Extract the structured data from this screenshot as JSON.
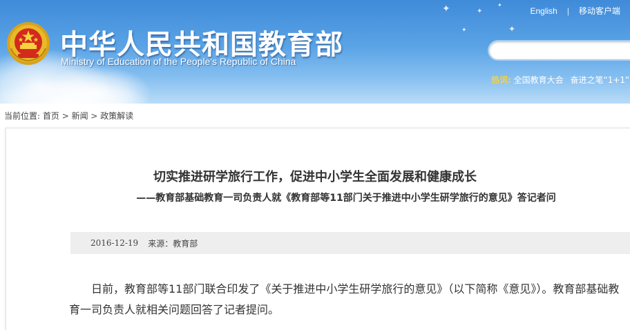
{
  "header": {
    "site_title": "中华人民共和国教育部",
    "site_subtitle": "Ministry of Education of the People's Republic of China",
    "top_links": [
      {
        "label": "English"
      },
      {
        "label": "移动客户端"
      }
    ],
    "search": {
      "value": "",
      "placeholder": ""
    },
    "hot": {
      "label": "热词:",
      "items": [
        "全国教育大会",
        "奋进之笔“1+1”"
      ]
    }
  },
  "breadcrumb": {
    "prefix": "当前位置:",
    "items": [
      "首页",
      "新闻",
      "政策解读"
    ],
    "separator": " > "
  },
  "article": {
    "title": "切实推进研学旅行工作，促进中小学生全面发展和健康成长",
    "subtitle": "——教育部基础教育一司负责人就《教育部等11部门关于推进中小学生研学旅行的意见》答记者问",
    "date": "2016-12-19",
    "source": "来源：教育部",
    "body": "日前，教育部等11部门联合印发了《关于推进中小学生研学旅行的意见》（以下简称《意见》）。教育部基础教育一司负责人就相关问题回答了记者提问。"
  },
  "colors": {
    "header_blue": "#3f8bd9",
    "hot_label": "#f7d23c",
    "meta_bar_bg": "#eeeeee",
    "text": "#333333"
  }
}
